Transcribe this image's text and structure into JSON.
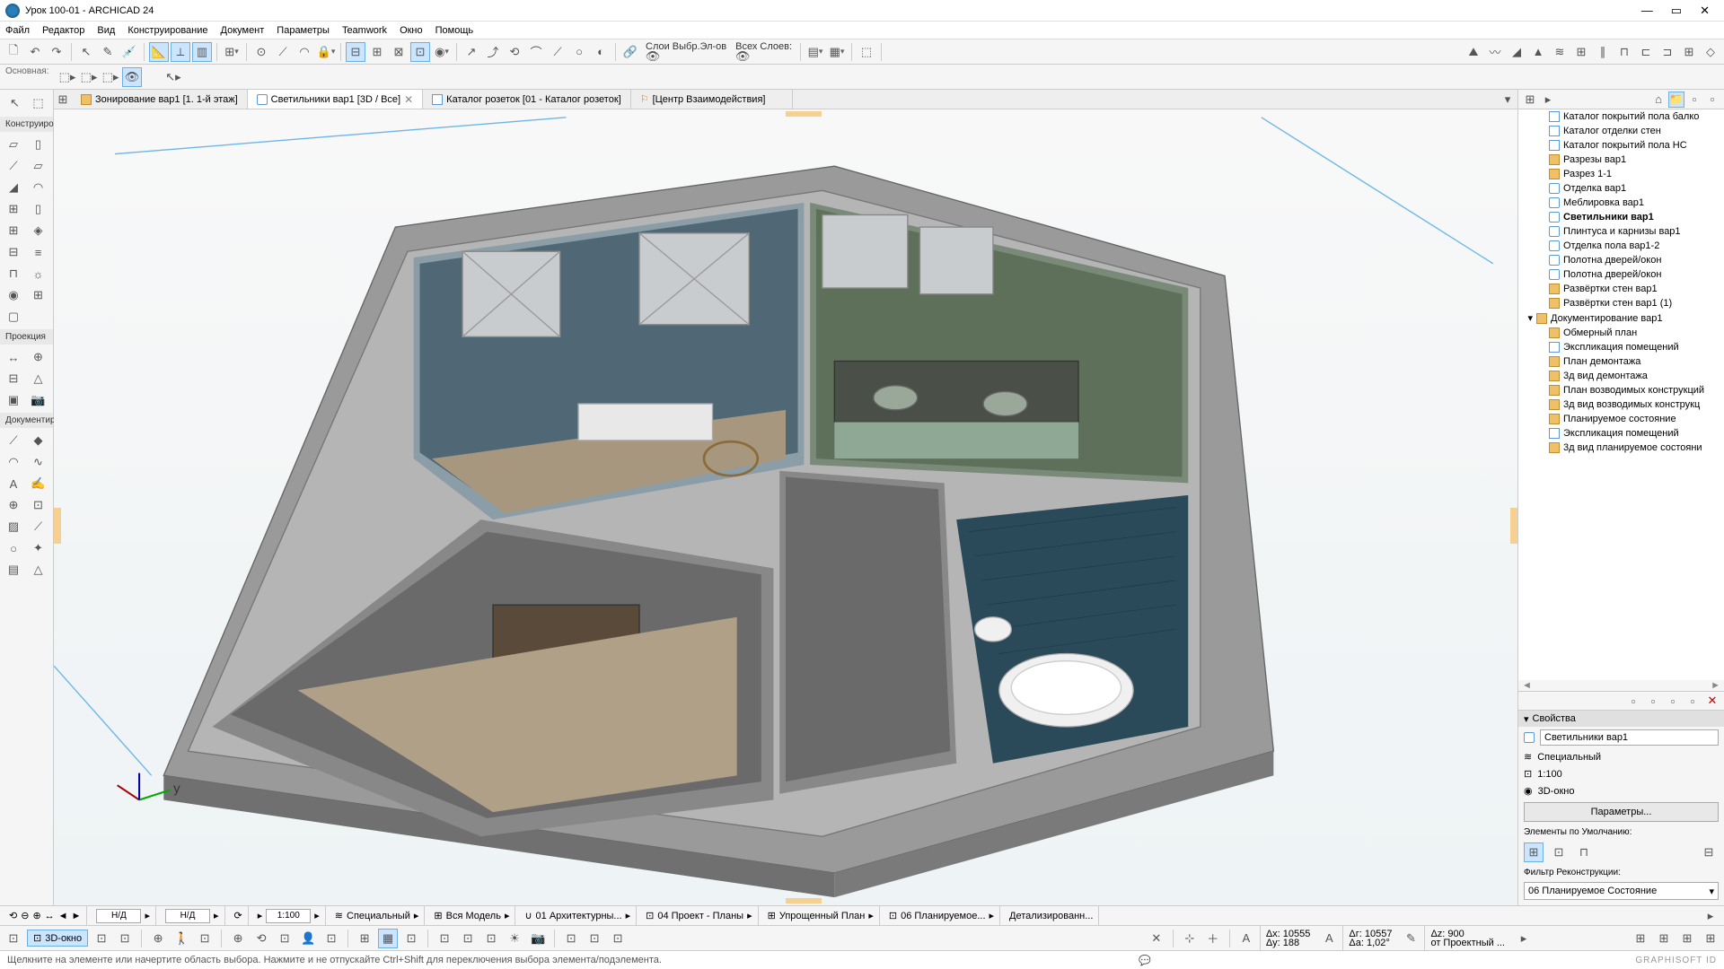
{
  "title": "Урок 100-01 - ARCHICAD 24",
  "menu": [
    "Файл",
    "Редактор",
    "Вид",
    "Конструирование",
    "Документ",
    "Параметры",
    "Teamwork",
    "Окно",
    "Помощь"
  ],
  "layer_labels": {
    "l1": "Слои Выбр.Эл-ов",
    "l2": "Всех Слоев:"
  },
  "row2_label": "Основная:",
  "left_sections": {
    "sel": "",
    "construct": "Конструиро",
    "project": "Проекция",
    "document": "Документир"
  },
  "tabs": [
    {
      "label": "Зонирование вар1 [1. 1-й этаж]",
      "icon": "folder",
      "active": false,
      "closable": false
    },
    {
      "label": "Светильники вар1 [3D / Все]",
      "icon": "view3d",
      "active": true,
      "closable": true
    },
    {
      "label": "Каталог розеток [01 - Каталог розеток]",
      "icon": "sheet",
      "active": false,
      "closable": false
    },
    {
      "label": "[Центр Взаимодействия]",
      "icon": "action",
      "active": false,
      "closable": false
    }
  ],
  "nav_items": [
    {
      "label": "Каталог покрытий пола балко",
      "icon": "sheet",
      "indent": 1
    },
    {
      "label": "Каталог отделки стен",
      "icon": "sheet",
      "indent": 1
    },
    {
      "label": "Каталог покрытий пола НС",
      "icon": "sheet",
      "indent": 1
    },
    {
      "label": "Разрезы вар1",
      "icon": "folder",
      "indent": 1
    },
    {
      "label": "Разрез 1-1",
      "icon": "folder",
      "indent": 1
    },
    {
      "label": "Отделка вар1",
      "icon": "view3d",
      "indent": 1
    },
    {
      "label": "Меблировка вар1",
      "icon": "view3d",
      "indent": 1
    },
    {
      "label": "Светильники вар1",
      "icon": "view3d",
      "indent": 1,
      "selected": true
    },
    {
      "label": "Плинтуса и карнизы вар1",
      "icon": "view3d",
      "indent": 1
    },
    {
      "label": "Отделка пола вар1-2",
      "icon": "view3d",
      "indent": 1
    },
    {
      "label": "Полотна дверей/окон",
      "icon": "view3d",
      "indent": 1
    },
    {
      "label": "Полотна дверей/окон",
      "icon": "view3d",
      "indent": 1
    },
    {
      "label": "Развёртки стен вар1",
      "icon": "folder",
      "indent": 1
    },
    {
      "label": "Развёртки стен вар1 (1)",
      "icon": "folder",
      "indent": 1
    },
    {
      "label": "Документирование вар1",
      "icon": "folder",
      "indent": 0,
      "expanded": true
    },
    {
      "label": "Обмерный план",
      "icon": "folder",
      "indent": 1
    },
    {
      "label": "Экспликация помещений",
      "icon": "sheet",
      "indent": 1
    },
    {
      "label": "План демонтажа",
      "icon": "folder",
      "indent": 1
    },
    {
      "label": "3д вид демонтажа",
      "icon": "folder",
      "indent": 1
    },
    {
      "label": "План возводимых конструкций",
      "icon": "folder",
      "indent": 1
    },
    {
      "label": "3д вид возводимых конструкц",
      "icon": "folder",
      "indent": 1
    },
    {
      "label": "Планируемое состояние",
      "icon": "folder",
      "indent": 1
    },
    {
      "label": "Экспликация помещений",
      "icon": "sheet",
      "indent": 1
    },
    {
      "label": "3д вид планируемое состояни",
      "icon": "folder",
      "indent": 1
    }
  ],
  "props": {
    "header": "Свойства",
    "name": "Светильники вар1",
    "special": "Специальный",
    "scale": "1:100",
    "window": "3D-окно",
    "params_btn": "Параметры...",
    "defaults_label": "Элементы по Умолчанию:",
    "filter_label": "Фильтр Реконструкции:",
    "filter_value": "06 Планируемое Состояние"
  },
  "quickbar": {
    "nd1": "Н/Д",
    "nd2": "Н/Д",
    "scale": "1:100",
    "combo1": "Специальный",
    "combo2": "Вся Модель",
    "combo3": "01 Архитектурны...",
    "combo4": "04 Проект - Планы",
    "combo5": "Упрощенный План",
    "combo6": "06 Планируемое...",
    "combo7": "Детализированн..."
  },
  "status2": {
    "btn": "3D-окно",
    "dx": "Δх: 10555",
    "dy": "Δу: 188",
    "dr": "Δг: 10557",
    "da": "Δа: 1,02°",
    "dz": "Δz: 900",
    "from": "от Проектный ..."
  },
  "hint": "Щелкните на элементе или начертите область выбора. Нажмите и не отпускайте Ctrl+Shift для переключения выбора элемента/подэлемента.",
  "gs_id": "GRAPHISOFT ID"
}
